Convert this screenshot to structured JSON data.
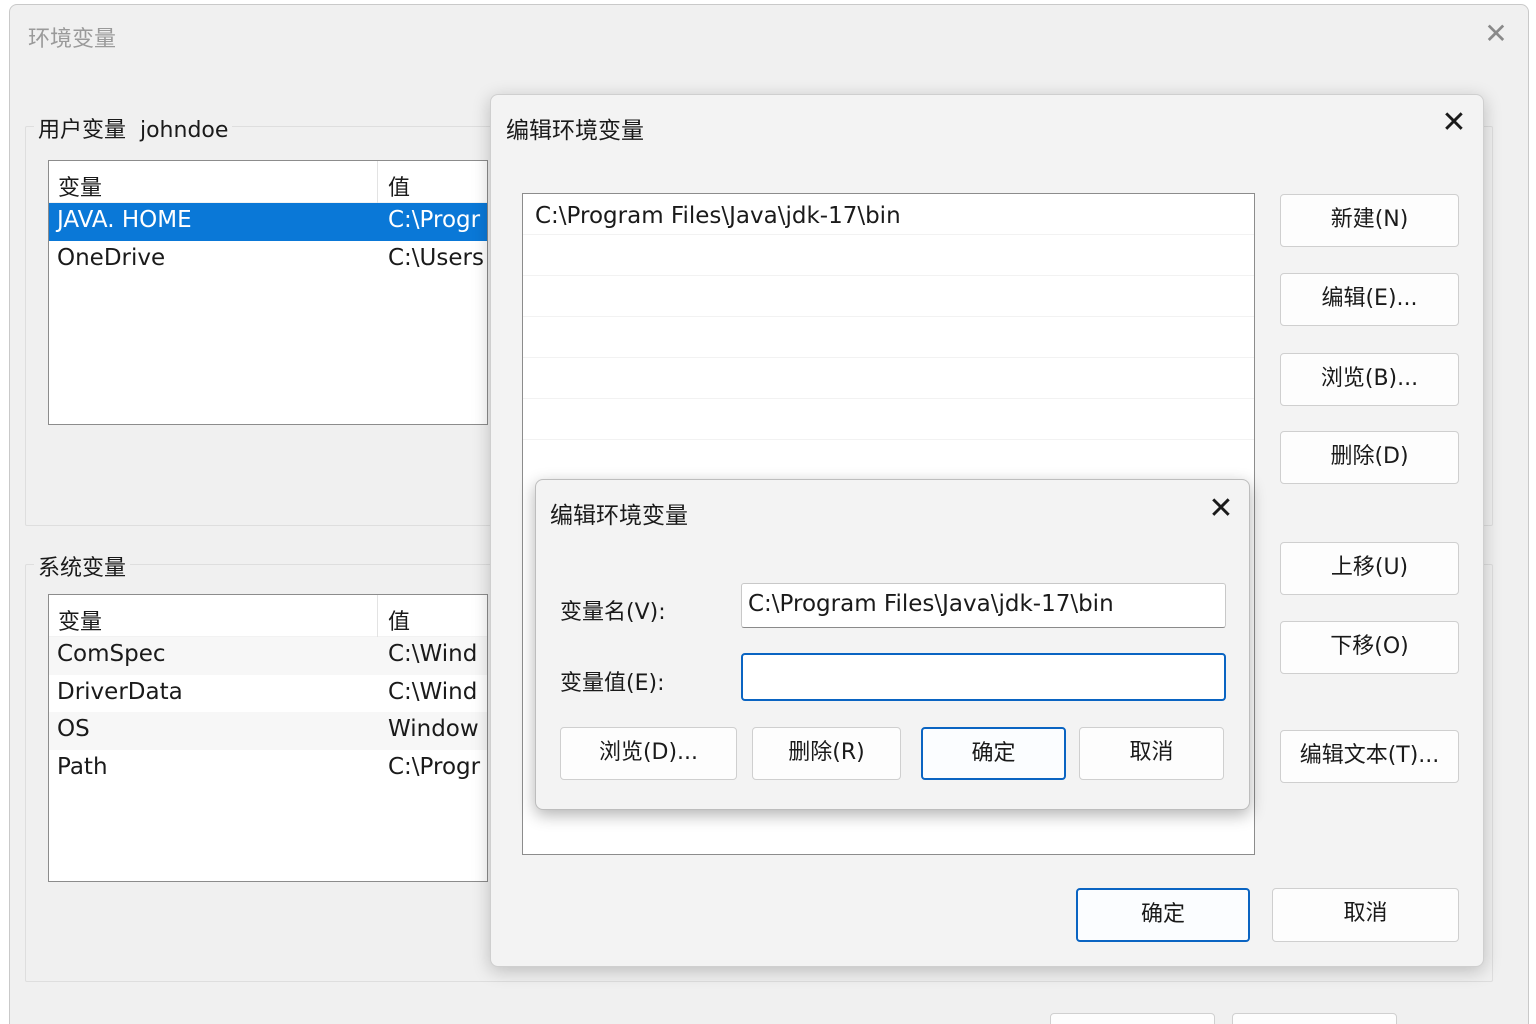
{
  "main_window": {
    "title": "环境变量",
    "user_group": {
      "legend": "用户变量  johndoe",
      "header": {
        "name": "变量",
        "value": "值"
      },
      "rows": [
        {
          "name": "JAVA. HOME",
          "value": "C:\\Progr",
          "selected": true
        },
        {
          "name": "OneDrive",
          "value": "C:\\Users"
        }
      ]
    },
    "system_group": {
      "legend": "系统变量",
      "header": {
        "name": "变量",
        "value": "值"
      },
      "rows": [
        {
          "name": "ComSpec",
          "value": "C:\\Wind"
        },
        {
          "name": "DriverData",
          "value": "C:\\Wind"
        },
        {
          "name": "OS",
          "value": "Window"
        },
        {
          "name": "Path",
          "value": "C:\\Progr"
        }
      ]
    }
  },
  "edit_dialog": {
    "title": "编辑环境变量",
    "path_entries": [
      "C:\\Program Files\\Java\\jdk-17\\bin",
      "",
      "",
      "",
      "",
      ""
    ],
    "buttons": {
      "new": "新建(N)",
      "edit": "编辑(E)...",
      "browse": "浏览(B)...",
      "delete": "删除(D)",
      "move_up": "上移(U)",
      "move_down": "下移(O)",
      "edit_text": "编辑文本(T)...",
      "ok": "确定",
      "cancel": "取消"
    }
  },
  "sub_dialog": {
    "title": "编辑环境变量",
    "name_label": "变量名(V):",
    "name_value": "C:\\Program Files\\Java\\jdk-17\\bin",
    "value_label": "变量值(E):",
    "value_value": "",
    "buttons": {
      "browse": "浏览(D)...",
      "delete": "删除(R)",
      "ok": "确定",
      "cancel": "取消"
    }
  },
  "icons": {
    "close": "close-icon"
  },
  "colors": {
    "selection": "#0a78d7",
    "focus_border": "#0a64c2"
  }
}
